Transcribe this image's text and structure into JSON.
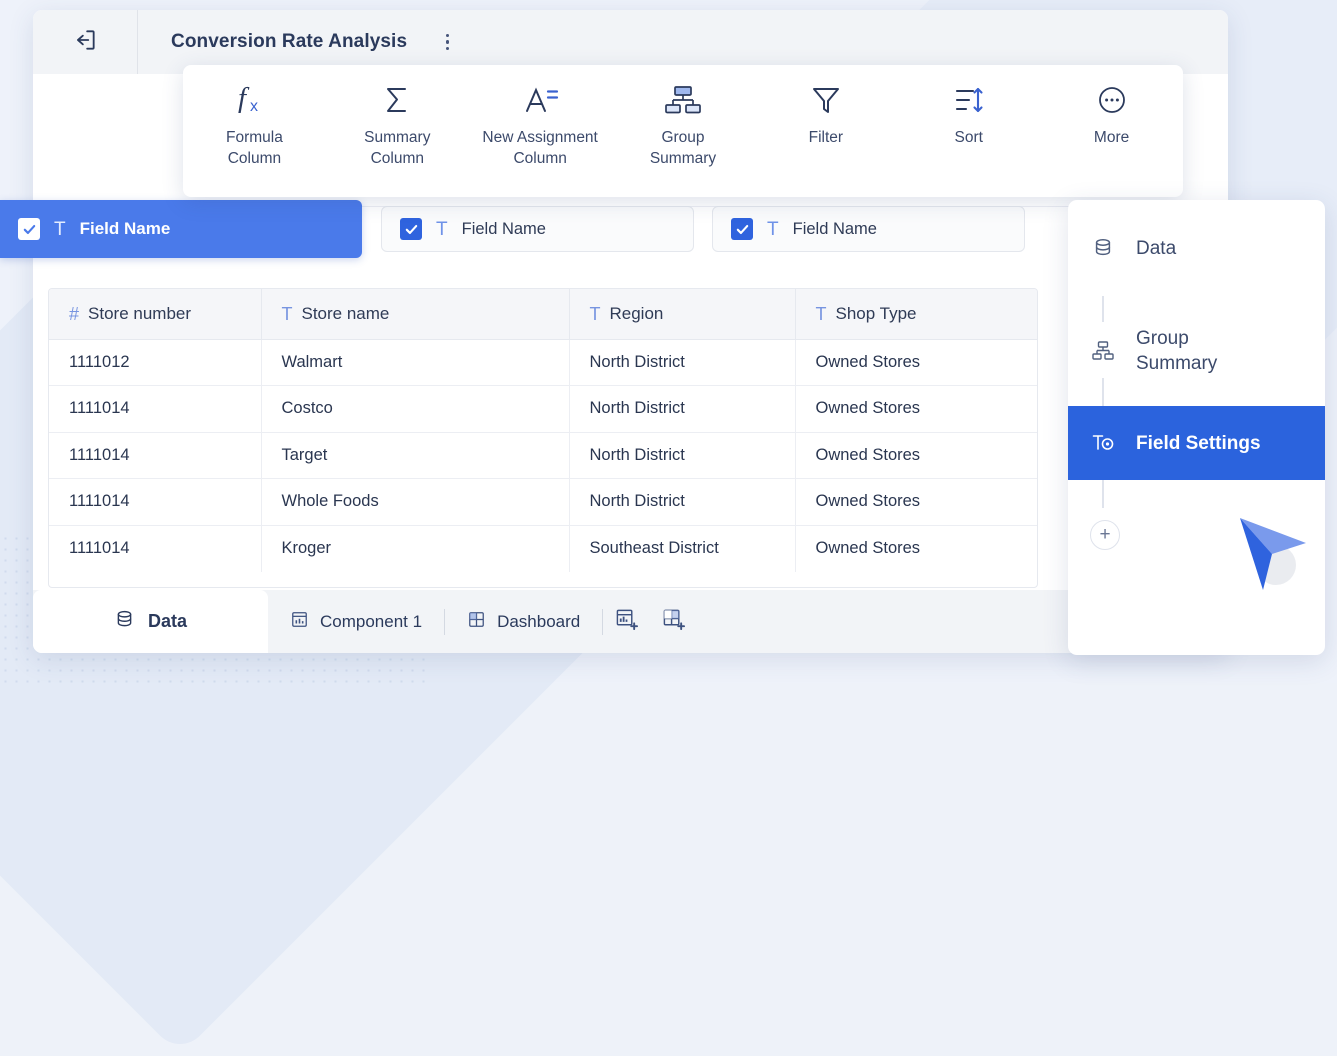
{
  "header": {
    "back_icon": "exit-arrow-icon",
    "title": "Conversion Rate Analysis",
    "menu_icon": "kebab-menu-icon"
  },
  "toolbar": {
    "items": [
      {
        "icon": "fx-icon",
        "label": "Formula\nColumn",
        "line1": "Formula",
        "line2": "Column"
      },
      {
        "icon": "sigma-icon",
        "label": "Summary\nColumn",
        "line1": "Summary",
        "line2": "Column"
      },
      {
        "icon": "a-equals-icon",
        "label": "New Assignment\nColumn",
        "line1": "New Assignment",
        "line2": "Column"
      },
      {
        "icon": "org-chart-icon",
        "label": "Group\nSummary",
        "line1": "Group",
        "line2": "Summary"
      },
      {
        "icon": "funnel-icon",
        "label": "Filter",
        "line1": "Filter",
        "line2": ""
      },
      {
        "icon": "sort-arrows-icon",
        "label": "Sort",
        "line1": "Sort",
        "line2": ""
      },
      {
        "icon": "ellipsis-circle-icon",
        "label": "More",
        "line1": "More",
        "line2": ""
      }
    ]
  },
  "field_chips": [
    {
      "label": "Field Name",
      "checked": true,
      "type_icon": "text-type-icon",
      "selected": true
    },
    {
      "label": "Field Name",
      "checked": true,
      "type_icon": "text-type-icon",
      "selected": false
    },
    {
      "label": "Field Name",
      "checked": true,
      "type_icon": "text-type-icon",
      "selected": false
    }
  ],
  "table": {
    "columns": [
      {
        "icon": "hash-number-icon",
        "label": "Store number"
      },
      {
        "icon": "text-type-icon",
        "label": "Store name"
      },
      {
        "icon": "text-type-icon",
        "label": "Region"
      },
      {
        "icon": "text-type-icon",
        "label": "Shop Type"
      }
    ],
    "rows": [
      [
        "1111012",
        "Walmart",
        "North District",
        "Owned Stores"
      ],
      [
        "1111014",
        "Costco",
        "North District",
        "Owned Stores"
      ],
      [
        "1111014",
        "Target",
        "North District",
        "Owned Stores"
      ],
      [
        "1111014",
        "Whole Foods",
        "North District",
        "Owned Stores"
      ],
      [
        "1111014",
        "Kroger",
        "Southeast District",
        "Owned Stores"
      ]
    ]
  },
  "tabbar": {
    "active_tab": {
      "icon": "database-icon",
      "label": "Data"
    },
    "tabs": [
      {
        "icon": "chart-card-icon",
        "label": "Component 1"
      },
      {
        "icon": "dashboard-grid-icon",
        "label": "Dashboard"
      }
    ],
    "add_buttons": [
      {
        "icon": "add-component-icon"
      },
      {
        "icon": "add-dashboard-icon"
      }
    ]
  },
  "side_panel": {
    "items": [
      {
        "icon": "database-icon",
        "label": "Data",
        "line1": "Data",
        "line2": "",
        "active": false
      },
      {
        "icon": "org-chart-icon",
        "label": "Group Summary",
        "line1": "Group",
        "line2": "Summary",
        "active": false
      },
      {
        "icon": "field-settings-icon",
        "label": "Field Settings",
        "line1": "Field Settings",
        "line2": "",
        "active": true
      }
    ],
    "add_button": {
      "icon": "plus-icon",
      "label": "+"
    }
  },
  "colors": {
    "accent_blue": "#2b63dd",
    "chip_blue": "#4a7aea",
    "icon_blue": "#7794e0",
    "text_dark": "#2b3a5c",
    "page_bg": "#eef2fa",
    "header_bg": "#f2f4f7"
  }
}
